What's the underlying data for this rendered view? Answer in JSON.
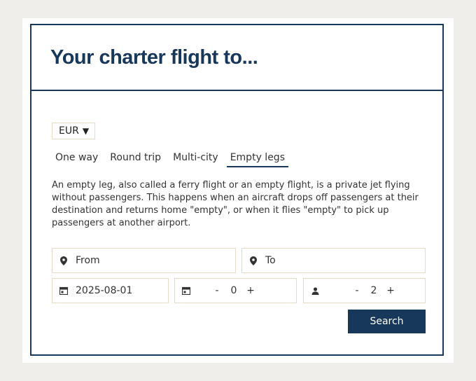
{
  "header": {
    "title": "Your charter flight to..."
  },
  "currency": {
    "value": "EUR",
    "caret": "▼"
  },
  "tabs": [
    {
      "label": "One way"
    },
    {
      "label": "Round trip"
    },
    {
      "label": "Multi-city"
    },
    {
      "label": "Empty legs",
      "active": true
    }
  ],
  "description": "An empty leg, also called a ferry flight or an empty flight, is a private jet flying without passengers. This happens when an aircraft drops off passengers at their destination and returns home \"empty\", or when it flies \"empty\" to pick up passengers at another airport.",
  "form": {
    "from_placeholder": "From",
    "to_placeholder": "To",
    "date_value": "2025-08-01",
    "days": {
      "minus": "-",
      "value": "0",
      "plus": "+"
    },
    "passengers": {
      "minus": "-",
      "value": "2",
      "plus": "+"
    },
    "search_label": "Search"
  },
  "colors": {
    "brand": "#17385a",
    "border": "#e6d9c6",
    "background": "#efeeeb"
  },
  "icons": [
    "map-pin-icon",
    "calendar-icon",
    "person-icon"
  ]
}
